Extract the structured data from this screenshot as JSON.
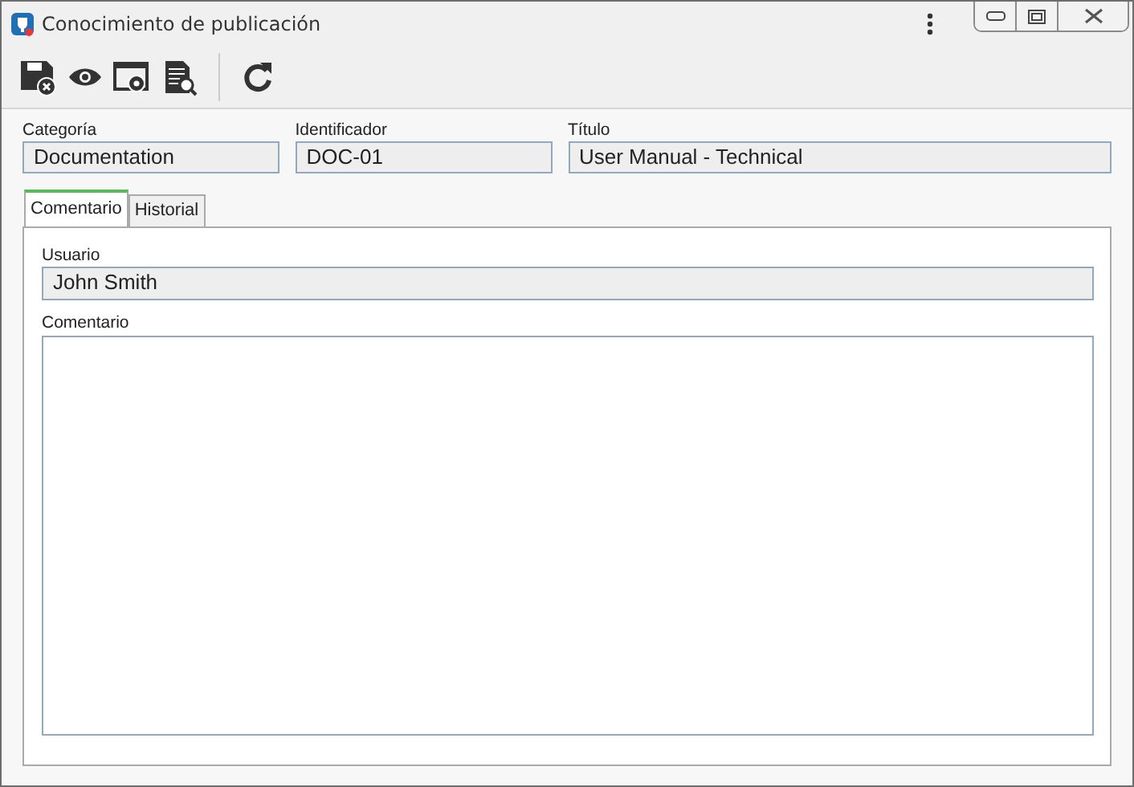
{
  "window": {
    "title": "Conocimiento de publicación"
  },
  "fields": [
    {
      "label": "Categoría",
      "value": "Documentation"
    },
    {
      "label": "Identificador",
      "value": "DOC-01"
    },
    {
      "label": "Título",
      "value": "User Manual - Technical"
    }
  ],
  "tabs": [
    {
      "label": "Comentario",
      "selected": true
    },
    {
      "label": "Historial",
      "selected": false
    }
  ],
  "user": {
    "label": "Usuario",
    "value": "John Smith"
  },
  "comment": {
    "label": "Comentario"
  }
}
